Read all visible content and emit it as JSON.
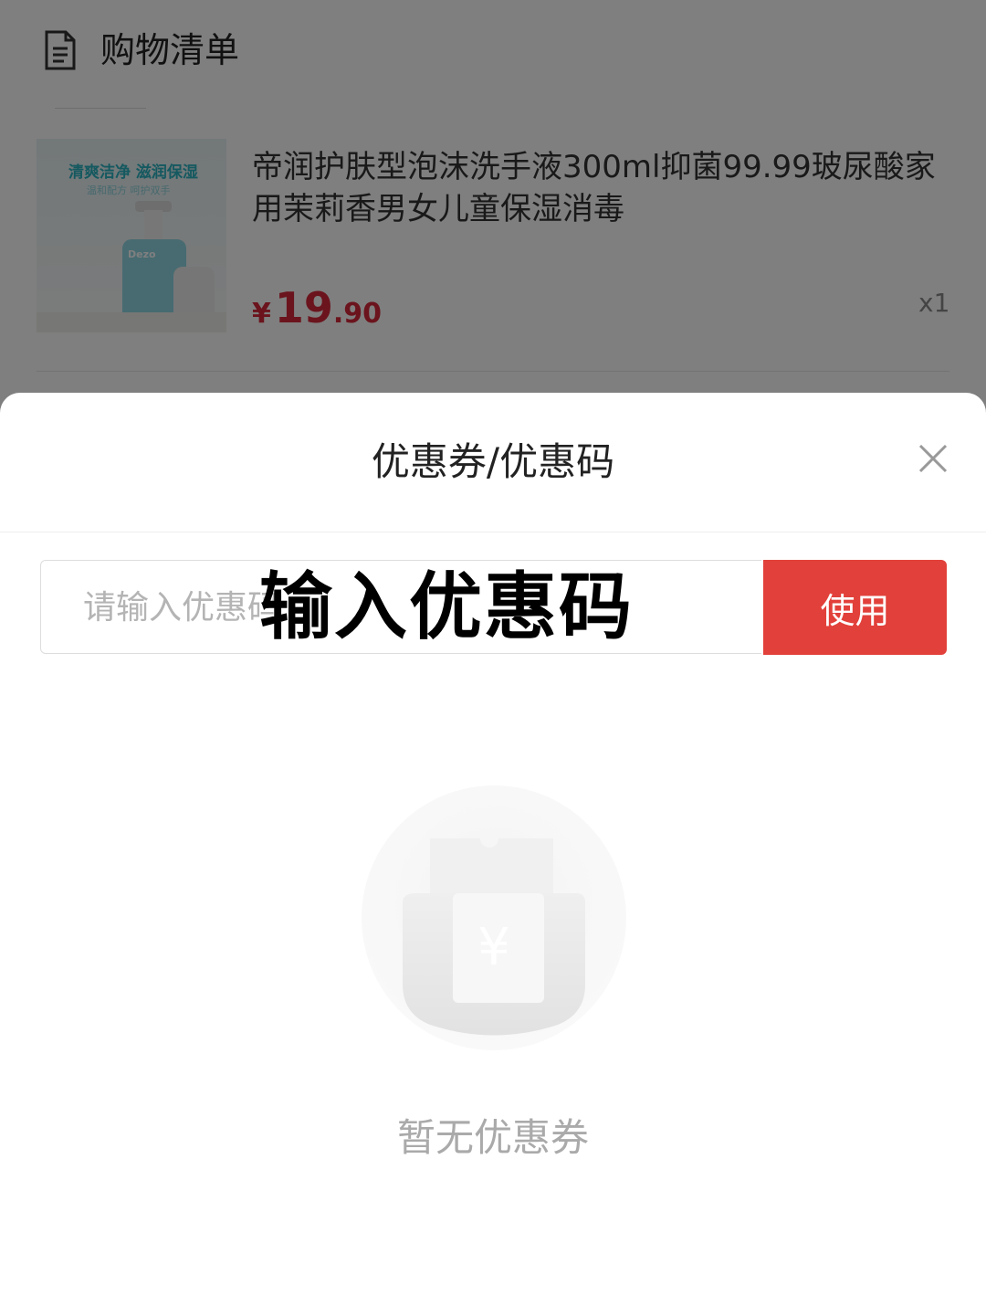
{
  "header": {
    "title": "购物清单",
    "icon": "document-list-icon"
  },
  "product": {
    "image_label_1": "清爽洁净 滋润保湿",
    "image_label_2": "温和配方 呵护双手",
    "image_brand": "Dezo",
    "title": "帝润护肤型泡沫洗手液300ml抑菌99.99玻尿酸家用茉莉香男女儿童保湿消毒",
    "price_symbol": "¥",
    "price_int": "19",
    "price_dec": ".90",
    "quantity": "x1",
    "price_color": "#d6293b"
  },
  "sheet": {
    "title": "优惠券/优惠码",
    "close_icon": "close-icon",
    "input_placeholder": "请输入优惠码",
    "input_value": "",
    "overlay_label": "输入优惠码",
    "use_button": "使用",
    "use_button_color": "#e2403a",
    "empty_icon": "empty-coupon-icon",
    "empty_text": "暂无优惠券"
  }
}
